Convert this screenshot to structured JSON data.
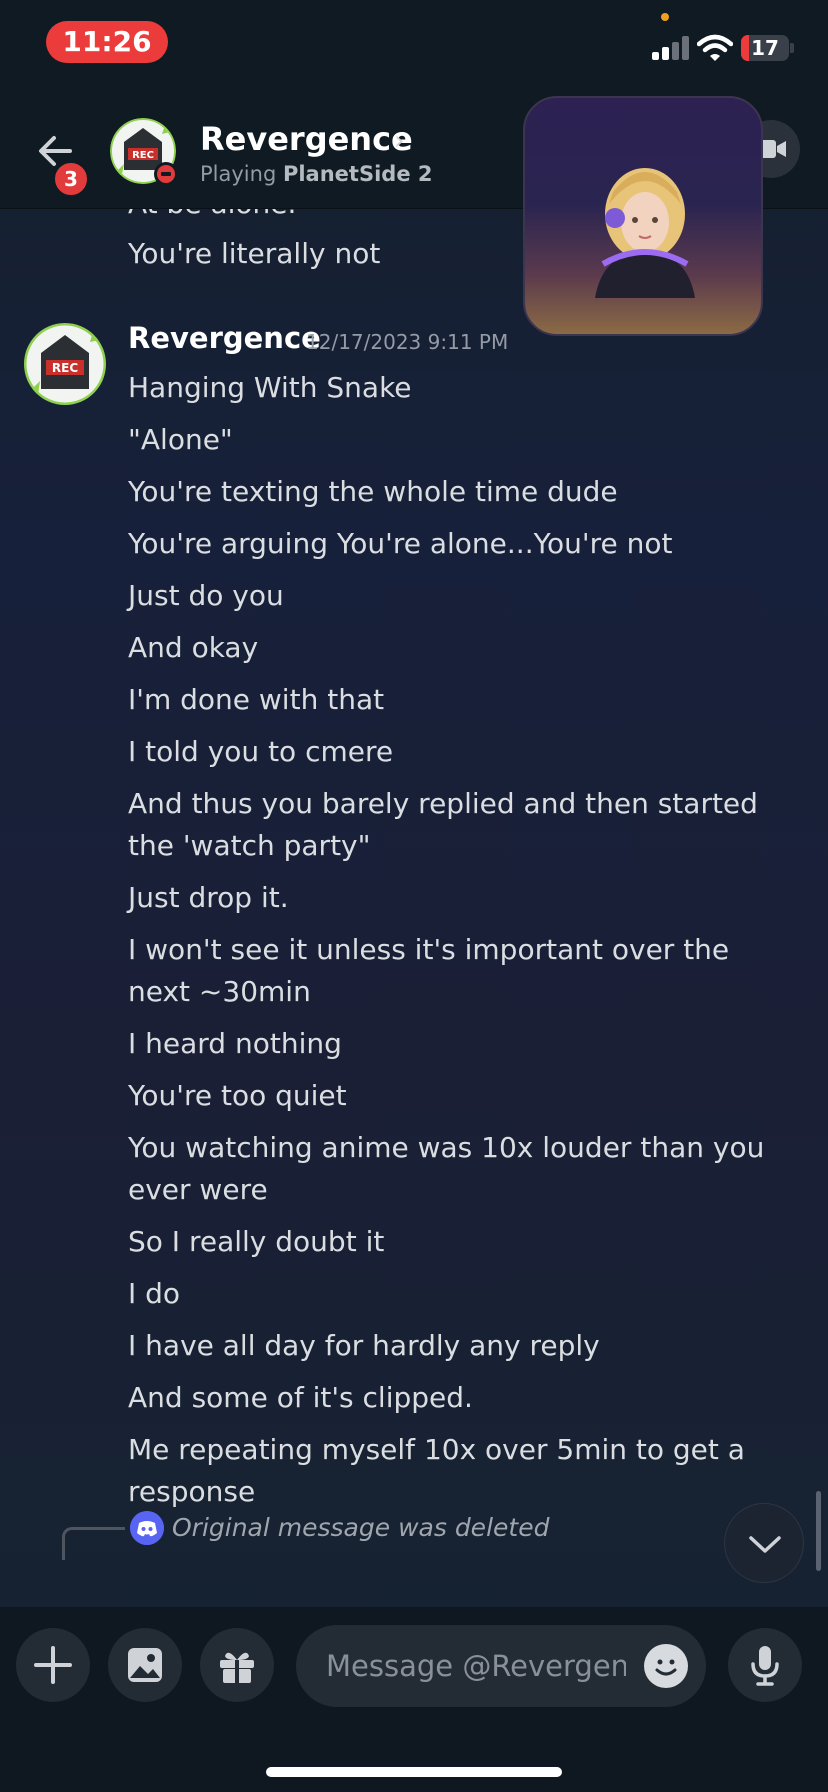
{
  "status_bar": {
    "time": "11:26",
    "battery": "17",
    "battery_level": 0.17
  },
  "header": {
    "unread_count": "3",
    "name": "Revergence",
    "status_prefix": "Playing",
    "status_game": "PlanetSide 2"
  },
  "avatar_logo_text": "REC",
  "messages": {
    "partial_line": "At be alone.",
    "previous_last_line": "You're literally not",
    "author": "Revergence",
    "timestamp": "12/17/2023 9:11 PM",
    "lines": [
      "Hanging With Snake",
      "\"Alone\"",
      "You're texting the whole time dude",
      "You're arguing You're alone...You're not",
      "Just do you",
      "And okay",
      "I'm done with that",
      "I told you to cmere",
      "And thus you barely replied and then started the 'watch party\"",
      "Just drop it.",
      "I won't see it unless it's important over the next ~30min",
      "I heard nothing",
      "You're too quiet",
      "You watching anime was 10x louder than you ever were",
      "So I really doubt it",
      "I do",
      "I have all day for hardly any reply",
      "And some of it's clipped.",
      "Me repeating myself 10x over 5min to get a response"
    ],
    "reply_preview": "Original message was deleted"
  },
  "composer": {
    "placeholder": "Message @Revergence"
  },
  "colors": {
    "accent": "#5865f2",
    "dnd": "#e23b3b",
    "record_pill": "#ec3b3b"
  }
}
